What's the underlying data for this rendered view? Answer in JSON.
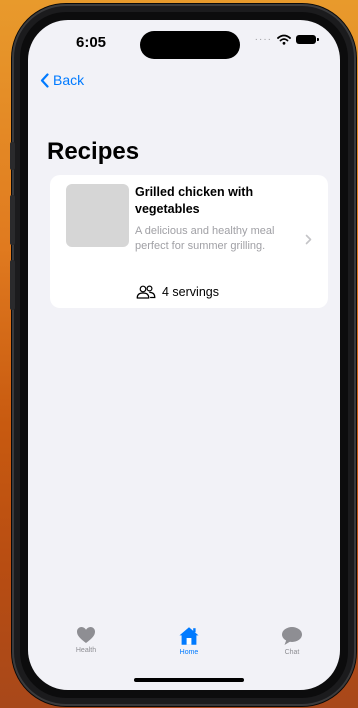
{
  "status_bar": {
    "time": "6:05"
  },
  "nav": {
    "back_label": "Back"
  },
  "page": {
    "title": "Recipes"
  },
  "recipes": [
    {
      "title": "Grilled chicken with vegetables",
      "description": "A delicious and healthy meal perfect for summer grilling.",
      "servings": "4 servings"
    }
  ],
  "tab_bar": {
    "tabs": [
      {
        "label": "Health",
        "icon": "heart-icon",
        "active": false
      },
      {
        "label": "Home",
        "icon": "house-icon",
        "active": true
      },
      {
        "label": "Chat",
        "icon": "chat-bubble-icon",
        "active": false
      }
    ]
  },
  "colors": {
    "accent": "#007aff",
    "inactive": "#8e8e93",
    "screen_bg": "#f2f2f7",
    "card_bg": "#ffffff",
    "thumbnail": "#d6d6d6"
  }
}
